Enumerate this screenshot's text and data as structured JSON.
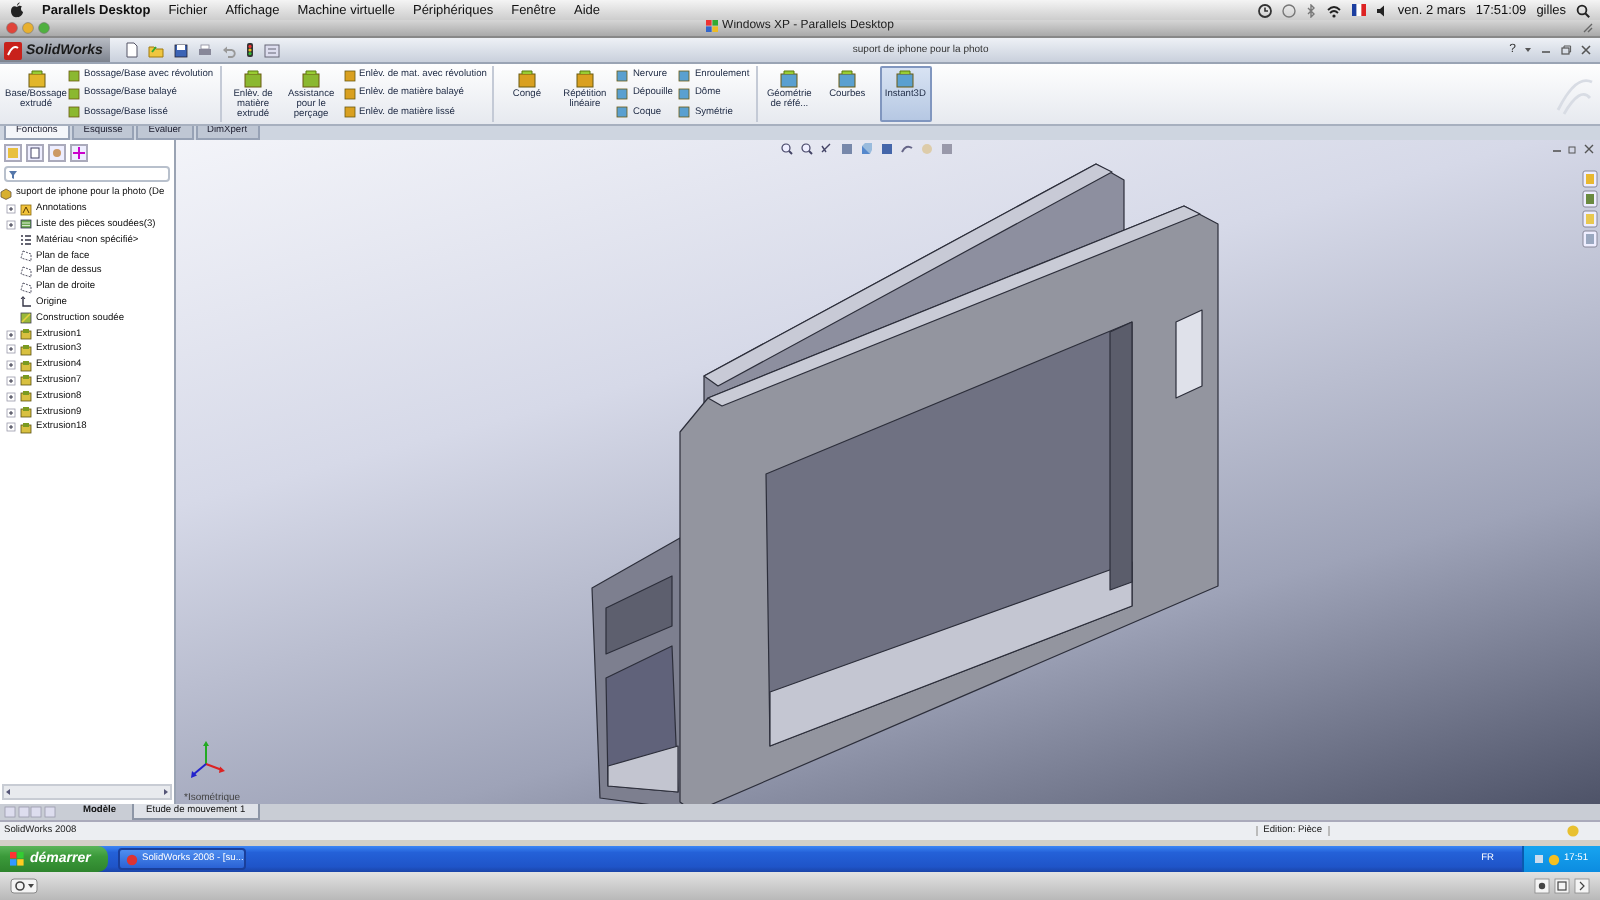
{
  "menu_bar": {
    "items": [
      "Parallels Desktop",
      "Fichier",
      "Affichage",
      "Machine virtuelle",
      "Périphériques",
      "Fenêtre",
      "Aide"
    ],
    "date": "ven. 2 mars",
    "time": "17:51:09",
    "user": "gilles"
  },
  "host_window": {
    "title": "Windows XP - Parallels Desktop"
  },
  "app": {
    "logo": "SolidWorks",
    "document_title": "suport de iphone pour la photo",
    "help": "?"
  },
  "ribbon": {
    "sections": [
      [
        {
          "kind": "large",
          "label": "Base/Bossage extrudé",
          "selected": false
        },
        {
          "kind": "stack",
          "items": [
            "Bossage/Base avec révolution",
            "Bossage/Base balayé",
            "Bossage/Base lissé"
          ]
        }
      ],
      [
        {
          "kind": "large",
          "label": "Enlèv. de matière extrudé",
          "selected": false
        },
        {
          "kind": "large",
          "label": "Assistance pour le perçage",
          "selected": false
        },
        {
          "kind": "stack",
          "items": [
            "Enlèv. de mat. avec révolution",
            "Enlèv. de matière balayé",
            "Enlèv. de matière lissé"
          ]
        }
      ],
      [
        {
          "kind": "large",
          "label": "Congé",
          "selected": false
        },
        {
          "kind": "large",
          "label": "Répétition linéaire",
          "selected": false
        },
        {
          "kind": "stack",
          "items": [
            "Nervure",
            "Dépouille",
            "Coque"
          ]
        },
        {
          "kind": "stack",
          "items": [
            "Enroulement",
            "Dôme",
            "Symétrie"
          ]
        }
      ],
      [
        {
          "kind": "large",
          "label": "Géométrie de réfé...",
          "selected": false
        },
        {
          "kind": "large",
          "label": "Courbes",
          "selected": false
        },
        {
          "kind": "large",
          "label": "Instant3D",
          "selected": true
        }
      ]
    ],
    "tabs": [
      {
        "label": "Fonctions",
        "selected": true
      },
      {
        "label": "Esquisse",
        "selected": false
      },
      {
        "label": "Evaluer",
        "selected": false
      },
      {
        "label": "DimXpert",
        "selected": false
      }
    ]
  },
  "feature_tree": {
    "root": "suport de iphone pour la photo  (De",
    "items": [
      {
        "label": "Annotations",
        "kind": "annotations",
        "expandable": true
      },
      {
        "label": "Liste des pièces soudées(3)",
        "kind": "cutlist",
        "expandable": true
      },
      {
        "label": "Matériau <non spécifié>",
        "kind": "material",
        "expandable": false
      },
      {
        "label": "Plan de face",
        "kind": "plane",
        "expandable": false
      },
      {
        "label": "Plan de dessus",
        "kind": "plane",
        "expandable": false
      },
      {
        "label": "Plan de droite",
        "kind": "plane",
        "expandable": false
      },
      {
        "label": "Origine",
        "kind": "origin",
        "expandable": false
      },
      {
        "label": "Construction soudée",
        "kind": "weldment",
        "expandable": false
      },
      {
        "label": "Extrusion1",
        "kind": "extrude",
        "expandable": true
      },
      {
        "label": "Extrusion3",
        "kind": "extrude",
        "expandable": true
      },
      {
        "label": "Extrusion4",
        "kind": "extrude",
        "expandable": true
      },
      {
        "label": "Extrusion7",
        "kind": "extrude",
        "expandable": true
      },
      {
        "label": "Extrusion8",
        "kind": "extrude",
        "expandable": true
      },
      {
        "label": "Extrusion9",
        "kind": "extrude",
        "expandable": true
      },
      {
        "label": "Extrusion18",
        "kind": "extrude",
        "expandable": true
      }
    ]
  },
  "viewport": {
    "view_label": "*Isométrique"
  },
  "bottom_tabs": [
    {
      "label": "Modèle",
      "selected": true
    },
    {
      "label": "Etude de mouvement 1",
      "selected": false
    }
  ],
  "status_bar": {
    "product": "SolidWorks 2008",
    "mode": "Edition: Pièce"
  },
  "taskbar": {
    "start": "démarrer",
    "tasks": [
      "SolidWorks 2008 - [su..."
    ],
    "language": "FR",
    "clock": "17:51"
  }
}
